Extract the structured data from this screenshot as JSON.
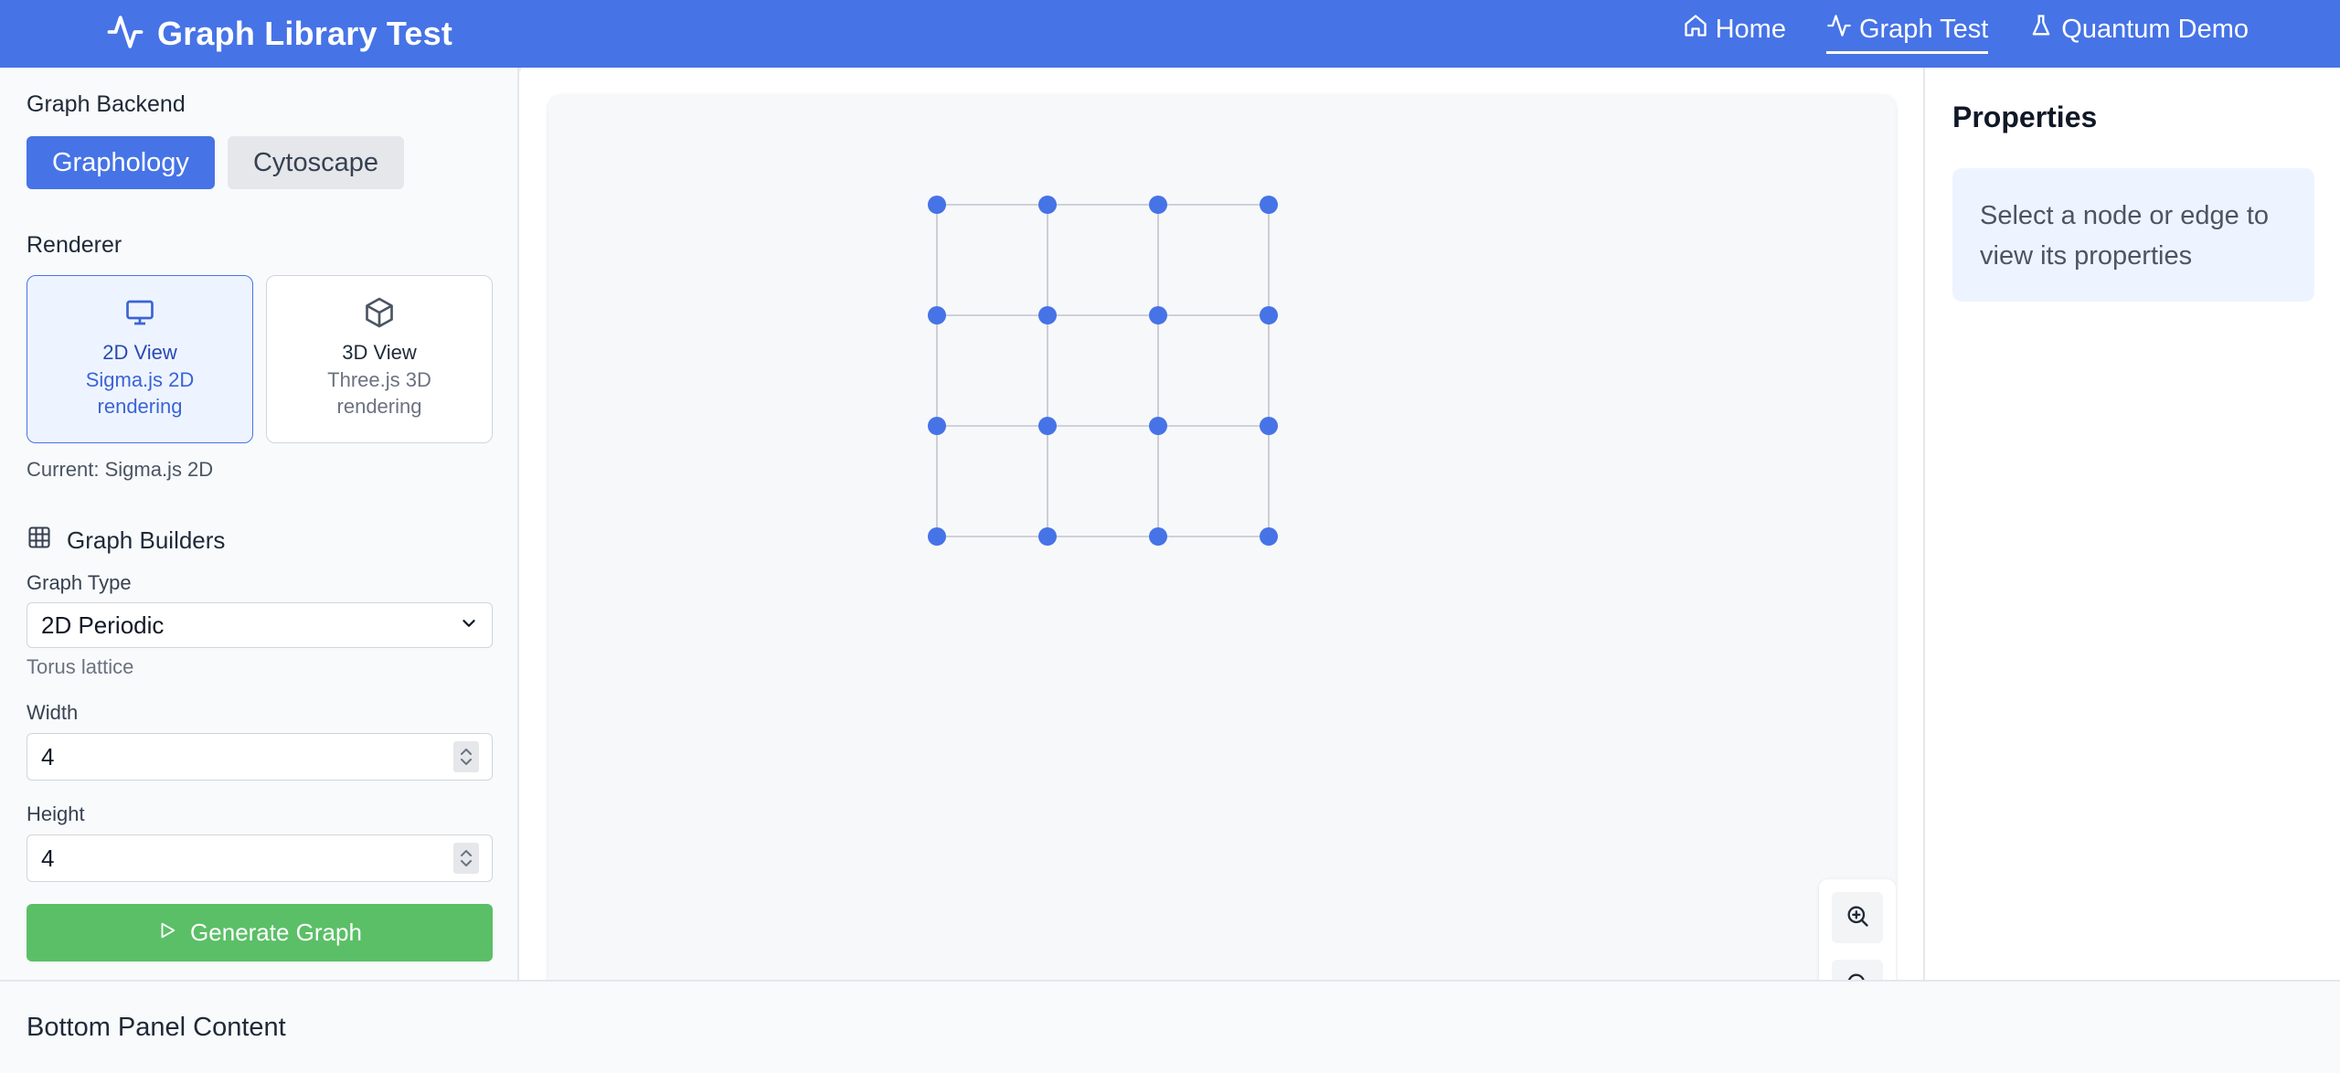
{
  "header": {
    "title": "Graph Library Test",
    "nav": [
      {
        "label": "Home",
        "icon": "home-icon"
      },
      {
        "label": "Graph Test",
        "icon": "activity-icon",
        "active": true
      },
      {
        "label": "Quantum Demo",
        "icon": "flask-icon"
      }
    ],
    "color": "#4673e6"
  },
  "sidebar": {
    "backend_label": "Graph Backend",
    "backends": [
      "Graphology",
      "Cytoscape"
    ],
    "renderer_label": "Renderer",
    "renderers": [
      {
        "title": "2D View",
        "desc": "Sigma.js 2D rendering",
        "icon": "monitor-icon",
        "active": true
      },
      {
        "title": "3D View",
        "desc": "Three.js 3D rendering",
        "icon": "cube-icon"
      }
    ],
    "current": "Current: Sigma.js 2D",
    "builders_label": "Graph Builders",
    "graph_type_label": "Graph Type",
    "graph_type_value": "2D Periodic",
    "graph_type_hint": "Torus lattice",
    "width_label": "Width",
    "width_value": "4",
    "height_label": "Height",
    "height_value": "4",
    "generate_label": "Generate Graph",
    "generate_color": "#5bbf67"
  },
  "graph": {
    "grid_cols": 4,
    "grid_rows": 4,
    "node_color": "#4673e6",
    "edge_color": "#c0c4cc"
  },
  "properties": {
    "title": "Properties",
    "empty_text": "Select a node or edge to view its properties"
  },
  "bottom": {
    "text": "Bottom Panel Content"
  }
}
